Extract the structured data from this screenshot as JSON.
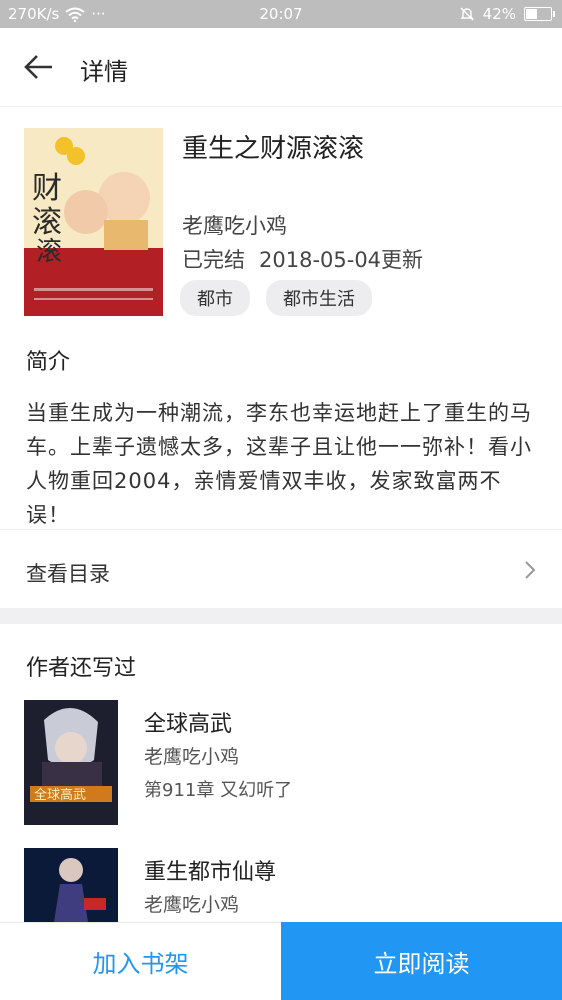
{
  "status_bar": {
    "speed": "270K/s",
    "dots": "···",
    "time": "20:07",
    "battery": "42%",
    "battery_level": 0.42
  },
  "header": {
    "title": "详情"
  },
  "book": {
    "title": "重生之财源滚滚",
    "author": "老鹰吃小鸡",
    "status": "已完结",
    "updated": "2018-05-04更新",
    "tags": [
      "都市",
      "都市生活"
    ]
  },
  "intro": {
    "title": "简介",
    "text": "当重生成为一种潮流，李东也幸运地赶上了重生的马车。上辈子遗憾太多，这辈子且让他一一弥补！看小人物重回2004，亲情爱情双丰收，发家致富两不误！"
  },
  "catalog": {
    "label": "查看目录"
  },
  "author_works": {
    "title": "作者还写过",
    "items": [
      {
        "title": "全球高武",
        "author": "老鹰吃小鸡",
        "chapter": "第911章 又幻听了"
      },
      {
        "title": "重生都市仙尊",
        "author": "老鹰吃小鸡",
        "chapter": ""
      }
    ]
  },
  "bottom": {
    "shelf_label": "加入书架",
    "read_label": "立即阅读"
  },
  "colors": {
    "accent": "#2196f3",
    "status_bar": "#bdbdbd"
  }
}
